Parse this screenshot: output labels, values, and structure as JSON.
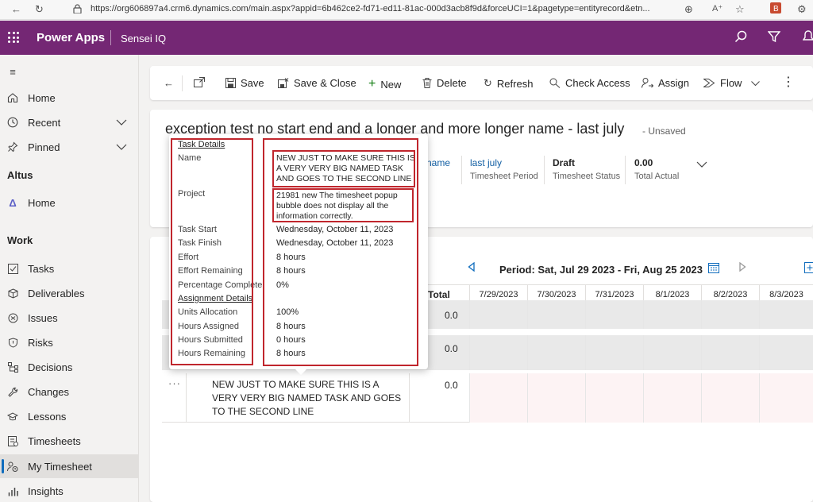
{
  "browser": {
    "url": "https://org606897a4.crm6.dynamics.com/main.aspx?appid=6b462ce2-fd71-ed11-81ac-000d3acb8f9d&forceUCI=1&pagetype=entityrecord&etn..."
  },
  "header": {
    "app_name": "Power Apps",
    "environment": "Sensei IQ"
  },
  "sidebar": {
    "top_items": [
      {
        "label": "Home",
        "icon": "home-icon"
      },
      {
        "label": "Recent",
        "icon": "clock-icon"
      },
      {
        "label": "Pinned",
        "icon": "pin-icon"
      }
    ],
    "section_altus": "Altus",
    "altus_items": [
      {
        "label": "Home",
        "icon": "delta-icon"
      }
    ],
    "section_work": "Work",
    "work_items": [
      {
        "label": "Tasks"
      },
      {
        "label": "Deliverables"
      },
      {
        "label": "Issues"
      },
      {
        "label": "Risks"
      },
      {
        "label": "Decisions"
      },
      {
        "label": "Changes"
      },
      {
        "label": "Lessons"
      },
      {
        "label": "Timesheets"
      },
      {
        "label": "My Timesheet"
      },
      {
        "label": "Insights"
      }
    ]
  },
  "commandbar": {
    "save": "Save",
    "save_close": "Save & Close",
    "new": "New",
    "delete": "Delete",
    "refresh": "Refresh",
    "check_access": "Check Access",
    "assign": "Assign",
    "flow": "Flow"
  },
  "record": {
    "title": "exception test no start end and a longer and more longer name - last july",
    "unsaved": "- Unsaved",
    "name_partial": "name",
    "period_value": "last july",
    "period_label": "Timesheet Period",
    "status_value": "Draft",
    "status_label": "Timesheet Status",
    "total_value": "0.00",
    "total_label": "Total Actual"
  },
  "grid": {
    "period": "Period: Sat, Jul 29 2023 - Fri, Aug 25 2023",
    "total_header": "Total",
    "days": [
      "7/29/2023",
      "7/30/2023",
      "7/31/2023",
      "8/1/2023",
      "8/2/2023",
      "8/3/2023"
    ],
    "rows": [
      {
        "total": "0.0"
      },
      {
        "total": "0.0"
      },
      {
        "total": "0.0",
        "task": "NEW JUST TO MAKE SURE THIS IS A VERY VERY BIG NAMED TASK AND GOES TO THE SECOND LINE"
      }
    ]
  },
  "popup": {
    "task_details_heading": "Task Details",
    "name_label": "Name",
    "name_value": "NEW JUST TO MAKE SURE THIS IS A VERY VERY BIG NAMED TASK AND GOES TO THE SECOND LINE",
    "project_label": "Project",
    "project_value": "21981 new The timesheet popup bubble does not display all the information correctly.",
    "task_start_label": "Task Start",
    "task_start_value": "Wednesday, October 11, 2023",
    "task_finish_label": "Task Finish",
    "task_finish_value": "Wednesday, October 11, 2023",
    "effort_label": "Effort",
    "effort_value": "8 hours",
    "effort_remaining_label": "Effort Remaining",
    "effort_remaining_value": "8 hours",
    "pct_complete_label": "Percentage Complete",
    "pct_complete_value": "0%",
    "assignment_heading": "Assignment Details",
    "units_label": "Units Allocation",
    "units_value": "100%",
    "hours_assigned_label": "Hours Assigned",
    "hours_assigned_value": "8 hours",
    "hours_submitted_label": "Hours Submitted",
    "hours_submitted_value": "0 hours",
    "hours_remaining_label": "Hours Remaining",
    "hours_remaining_value": "8 hours"
  },
  "colors": {
    "header_bg": "#742774",
    "annotation_red": "#c0262d",
    "link_blue": "#115ea3"
  }
}
